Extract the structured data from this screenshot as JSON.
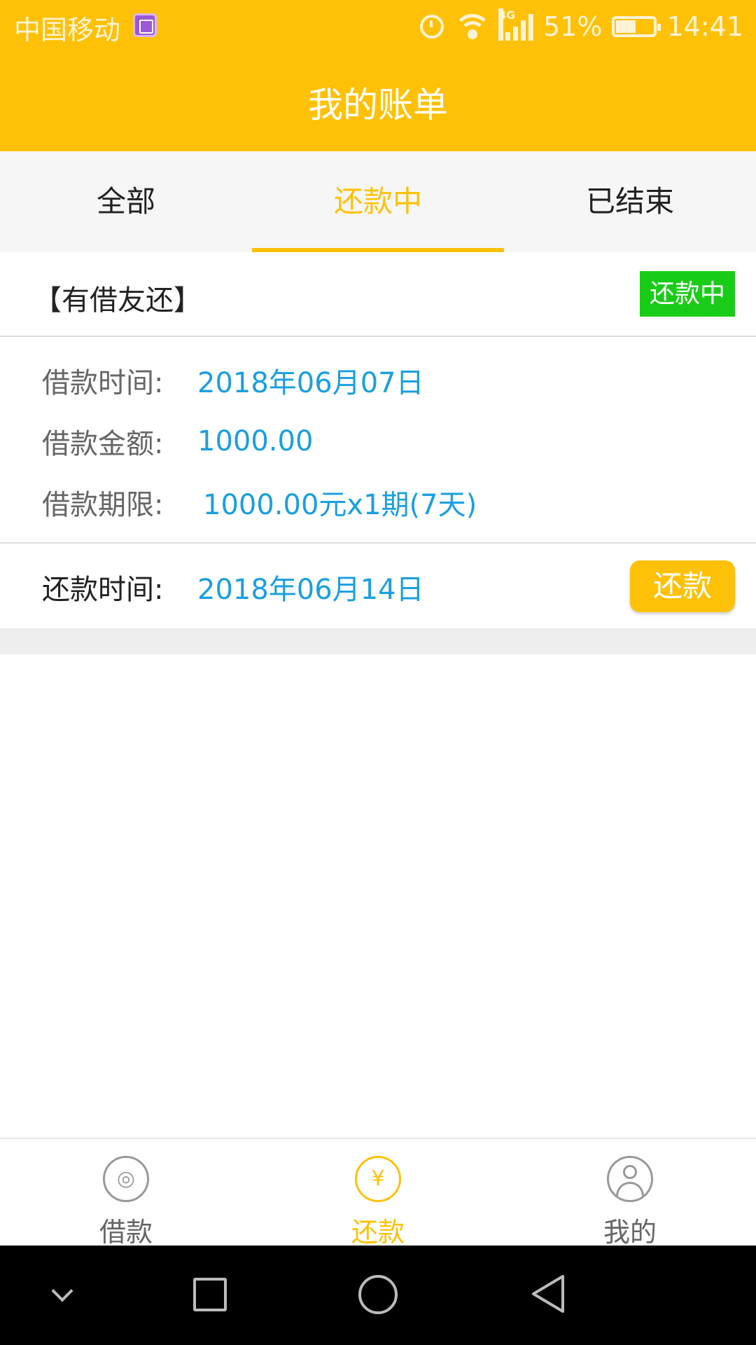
{
  "status_bar": {
    "carrier": "中国移动",
    "network": "4G",
    "battery": "51%",
    "time": "14:41"
  },
  "header": {
    "title": "我的账单"
  },
  "tabs": [
    {
      "label": "全部"
    },
    {
      "label": "还款中",
      "active": true
    },
    {
      "label": "已结束"
    }
  ],
  "bill": {
    "name": "【有借友还】",
    "status": "还款中",
    "loan_time_label": "借款时间:",
    "loan_time": "2018年06月07日",
    "loan_amount_label": "借款金额:",
    "loan_amount": "1000.00",
    "loan_term_label": "借款期限:",
    "loan_term": "1000.00元x1期(7天)",
    "repay_time_label": "还款时间:",
    "repay_time": "2018年06月14日",
    "repay_button": "还款"
  },
  "bottom_nav": [
    {
      "label": "借款",
      "icon": "coins-icon"
    },
    {
      "label": "还款",
      "icon": "yuan-icon",
      "active": true
    },
    {
      "label": "我的",
      "icon": "user-icon"
    }
  ],
  "colors": {
    "accent": "#FFC107",
    "value_blue": "#1a9fe0",
    "status_green": "#19cc17"
  }
}
